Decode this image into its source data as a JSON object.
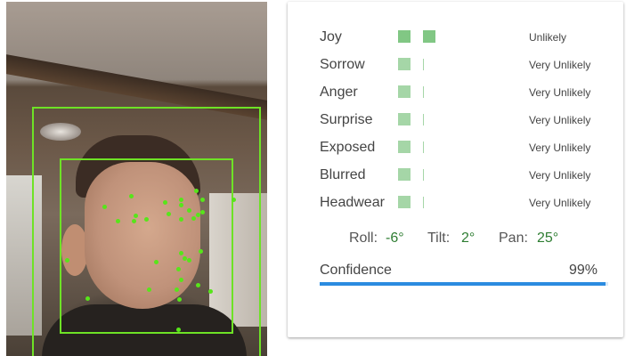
{
  "emotions": [
    {
      "label": "Joy",
      "value": "Unlikely",
      "level": 2
    },
    {
      "label": "Sorrow",
      "value": "Very Unlikely",
      "level": 1
    },
    {
      "label": "Anger",
      "value": "Very Unlikely",
      "level": 1
    },
    {
      "label": "Surprise",
      "value": "Very Unlikely",
      "level": 1
    },
    {
      "label": "Exposed",
      "value": "Very Unlikely",
      "level": 1
    },
    {
      "label": "Blurred",
      "value": "Very Unlikely",
      "level": 1
    },
    {
      "label": "Headwear",
      "value": "Very Unlikely",
      "level": 1
    }
  ],
  "angles": {
    "roll_label": "Roll:",
    "roll_value": "-6°",
    "tilt_label": "Tilt:",
    "tilt_value": "2°",
    "pan_label": "Pan:",
    "pan_value": "25°"
  },
  "confidence": {
    "label": "Confidence",
    "value": "99%",
    "fraction": 0.99
  },
  "colors": {
    "likely_strong": "#81c784",
    "likely_weak": "#a5d6a7",
    "detection_box": "#6ee226",
    "landmark": "#57e51a",
    "confidence_bar": "#2b8be0",
    "angle_value": "#2e7d32"
  }
}
